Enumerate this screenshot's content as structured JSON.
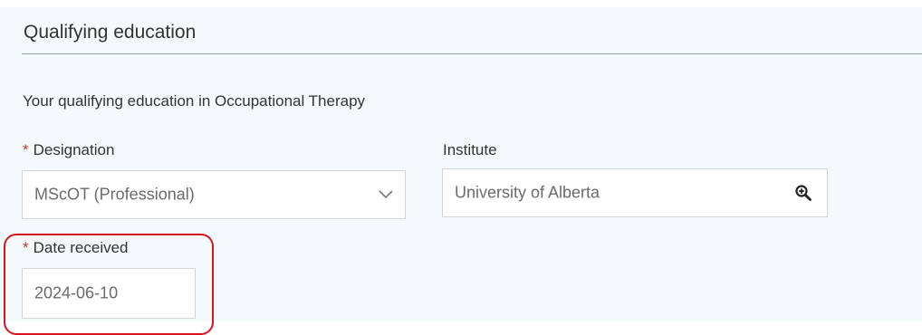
{
  "section": {
    "title": "Qualifying education",
    "intro": "Your qualifying education in Occupational Therapy"
  },
  "fields": {
    "designation": {
      "required_marker": "*",
      "label": "Designation",
      "value": "MScOT (Professional)"
    },
    "institute": {
      "label": "Institute",
      "value": "University of Alberta"
    },
    "date_received": {
      "required_marker": "*",
      "label": "Date received",
      "value": "2024-06-10"
    }
  },
  "icons": {
    "designation_dropdown": "chevron-down-icon",
    "institute_lookup": "zoom-in-icon"
  },
  "colors": {
    "required": "#c0392b",
    "highlight": "#d9141e",
    "panel_background": "#f4f9fb"
  }
}
